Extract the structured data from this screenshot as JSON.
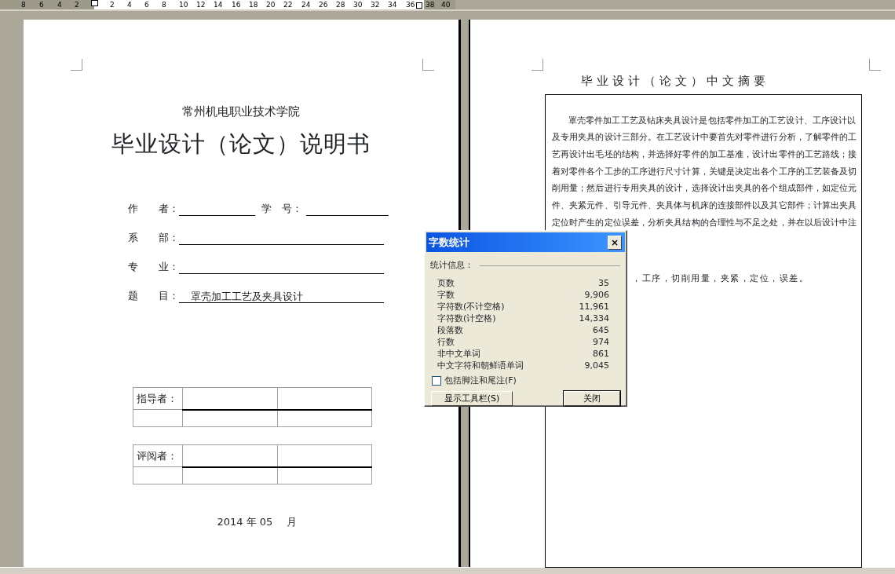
{
  "ruler": {
    "labels": [
      "8",
      "6",
      "4",
      "2",
      "2",
      "4",
      "6",
      "8",
      "10",
      "12",
      "14",
      "16",
      "18",
      "20",
      "22",
      "24",
      "26",
      "28",
      "30",
      "32",
      "34",
      "36",
      "38",
      "40"
    ]
  },
  "left_page": {
    "school": "常州机电职业技术学院",
    "title": "毕业设计（论文）说明书",
    "fields": [
      {
        "items": [
          {
            "label": "作　　者："
          },
          {
            "label": "学　号："
          }
        ]
      },
      {
        "items": [
          {
            "label": "系　　部："
          }
        ]
      },
      {
        "items": [
          {
            "label": "专　　业："
          }
        ]
      },
      {
        "items": [
          {
            "label": "题　　目：",
            "value": "罩壳加工工艺及夹具设计"
          }
        ]
      }
    ],
    "sign_tables": [
      {
        "label": "指导者："
      },
      {
        "label": "评阅者："
      }
    ],
    "date": "2014  年  05　 月"
  },
  "right_page": {
    "title": "毕业设计（论文）中文摘要",
    "abstract_lines": [
      "罩壳零件加工工艺及钻床夹具设计是包括零件加工的工艺设计、工序设计以",
      "及专用夹具的设计三部分。在工艺设计中要首先对零件进行分析，了解零件的工",
      "艺再设计出毛坯的结构，并选择好零件的加工基准，设计出零件的工艺路线；接",
      "着对零件各个工步的工序进行尺寸计算，关键是决定出各个工序的工艺装备及切",
      "削用量；然后进行专用夹具的设计，选择设计出夹具的各个组成部件，如定位元",
      "件、夹紧元件、引导元件、夹具体与机床的连接部件以及其它部件；计算出夹具",
      "定位时产生的定位误差，分析夹具结构的合理性与不足之处，并在以后设计中注"
    ],
    "keywords_fragment": "，工序，切削用量，夹紧，定位，误差。"
  },
  "dialog": {
    "title": "字数统计",
    "close_glyph": "×",
    "section": "统计信息：",
    "stats": [
      {
        "label": "页数",
        "value": "35"
      },
      {
        "label": "字数",
        "value": "9,906"
      },
      {
        "label": "字符数(不计空格)",
        "value": "11,961"
      },
      {
        "label": "字符数(计空格)",
        "value": "14,334"
      },
      {
        "label": "段落数",
        "value": "645"
      },
      {
        "label": "行数",
        "value": "974"
      },
      {
        "label": "非中文单词",
        "value": "861"
      },
      {
        "label": "中文字符和朝鲜语单词",
        "value": "9,045"
      }
    ],
    "checkbox": {
      "label": "包括脚注和尾注(F)",
      "checked": false
    },
    "buttons": [
      {
        "label": "显示工具栏(S)",
        "default": false
      },
      {
        "label": "关闭",
        "default": true
      }
    ]
  }
}
